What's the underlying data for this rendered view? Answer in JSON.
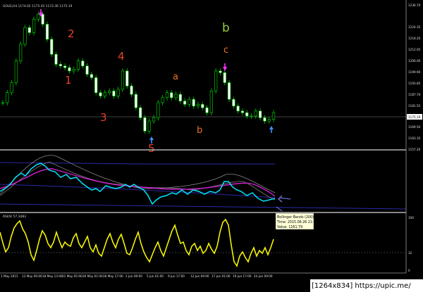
{
  "chart_data": [
    {
      "type": "candlestick",
      "title": "GOLD,H4 1174.62 1175.45 1173.36 1175.19",
      "price_axis": [
        "1236.70",
        "1224.35",
        "1218.20",
        "1212.05",
        "1206.00",
        "1199.90",
        "1193.85",
        "1187.70",
        "1181.55",
        "1175.19",
        "1169.50",
        "1163.35",
        "1157.20"
      ],
      "ylim": [
        1154,
        1240
      ],
      "current_price": 1175.19,
      "x_axis": [
        "1 May 2015",
        "13 May 09:00",
        "18 May 13:00",
        "21 May 05:00",
        "26 May 01:00",
        "28 May 17:00",
        "2 Jun 09:00",
        "5 Jun 01:00",
        "9 Jun 17:00",
        "12 Jun 09:00",
        "17 Jun 01:00",
        "19 Jun 17:00",
        "24 Jun 09:00"
      ],
      "close_path": [
        1181,
        1187,
        1193,
        1206,
        1216,
        1226,
        1223,
        1231,
        1234,
        1228,
        1219,
        1210,
        1204,
        1203,
        1202,
        1200,
        1201,
        1206,
        1203,
        1198,
        1196,
        1187,
        1185,
        1187,
        1188,
        1185,
        1189,
        1200,
        1191,
        1186,
        1178,
        1172,
        1164,
        1170,
        1172,
        1181,
        1184,
        1187,
        1184,
        1186,
        1182,
        1180,
        1183,
        1179,
        1180,
        1178,
        1175,
        1188,
        1200,
        1199,
        1193,
        1183,
        1179,
        1176,
        1175,
        1173,
        1173,
        1176,
        1172,
        1170,
        1171,
        1175
      ],
      "wave_labels": [
        {
          "text": "1",
          "style": "red"
        },
        {
          "text": "2",
          "style": "red"
        },
        {
          "text": "3",
          "style": "red"
        },
        {
          "text": "4",
          "style": "red"
        },
        {
          "text": "5",
          "style": "red"
        },
        {
          "text": "a",
          "style": "orange"
        },
        {
          "text": "b",
          "style": "orange"
        },
        {
          "text": "b",
          "style": "green"
        },
        {
          "text": "c",
          "style": "orange"
        }
      ],
      "arrows": [
        {
          "kind": "down",
          "color": "#ff33ff"
        },
        {
          "kind": "up",
          "color": "#3f8fff"
        },
        {
          "kind": "down",
          "color": "#ff33ff"
        },
        {
          "kind": "up",
          "color": "#3f8fff"
        }
      ]
    },
    {
      "type": "line",
      "name": "Bollinger Bands (200)",
      "tooltip": {
        "line1": "Bollinger Bands (200)",
        "line2": "Time: 2015.06.26 21:00",
        "line3": "Value: 1161.79"
      }
    },
    {
      "type": "line",
      "title": "RSI(9) 57.3483",
      "axis": [
        "100",
        "32",
        "0"
      ],
      "series_color": "#ffff00"
    }
  ],
  "footer": {
    "watermark": "[1264x834] https://upic.me/"
  }
}
